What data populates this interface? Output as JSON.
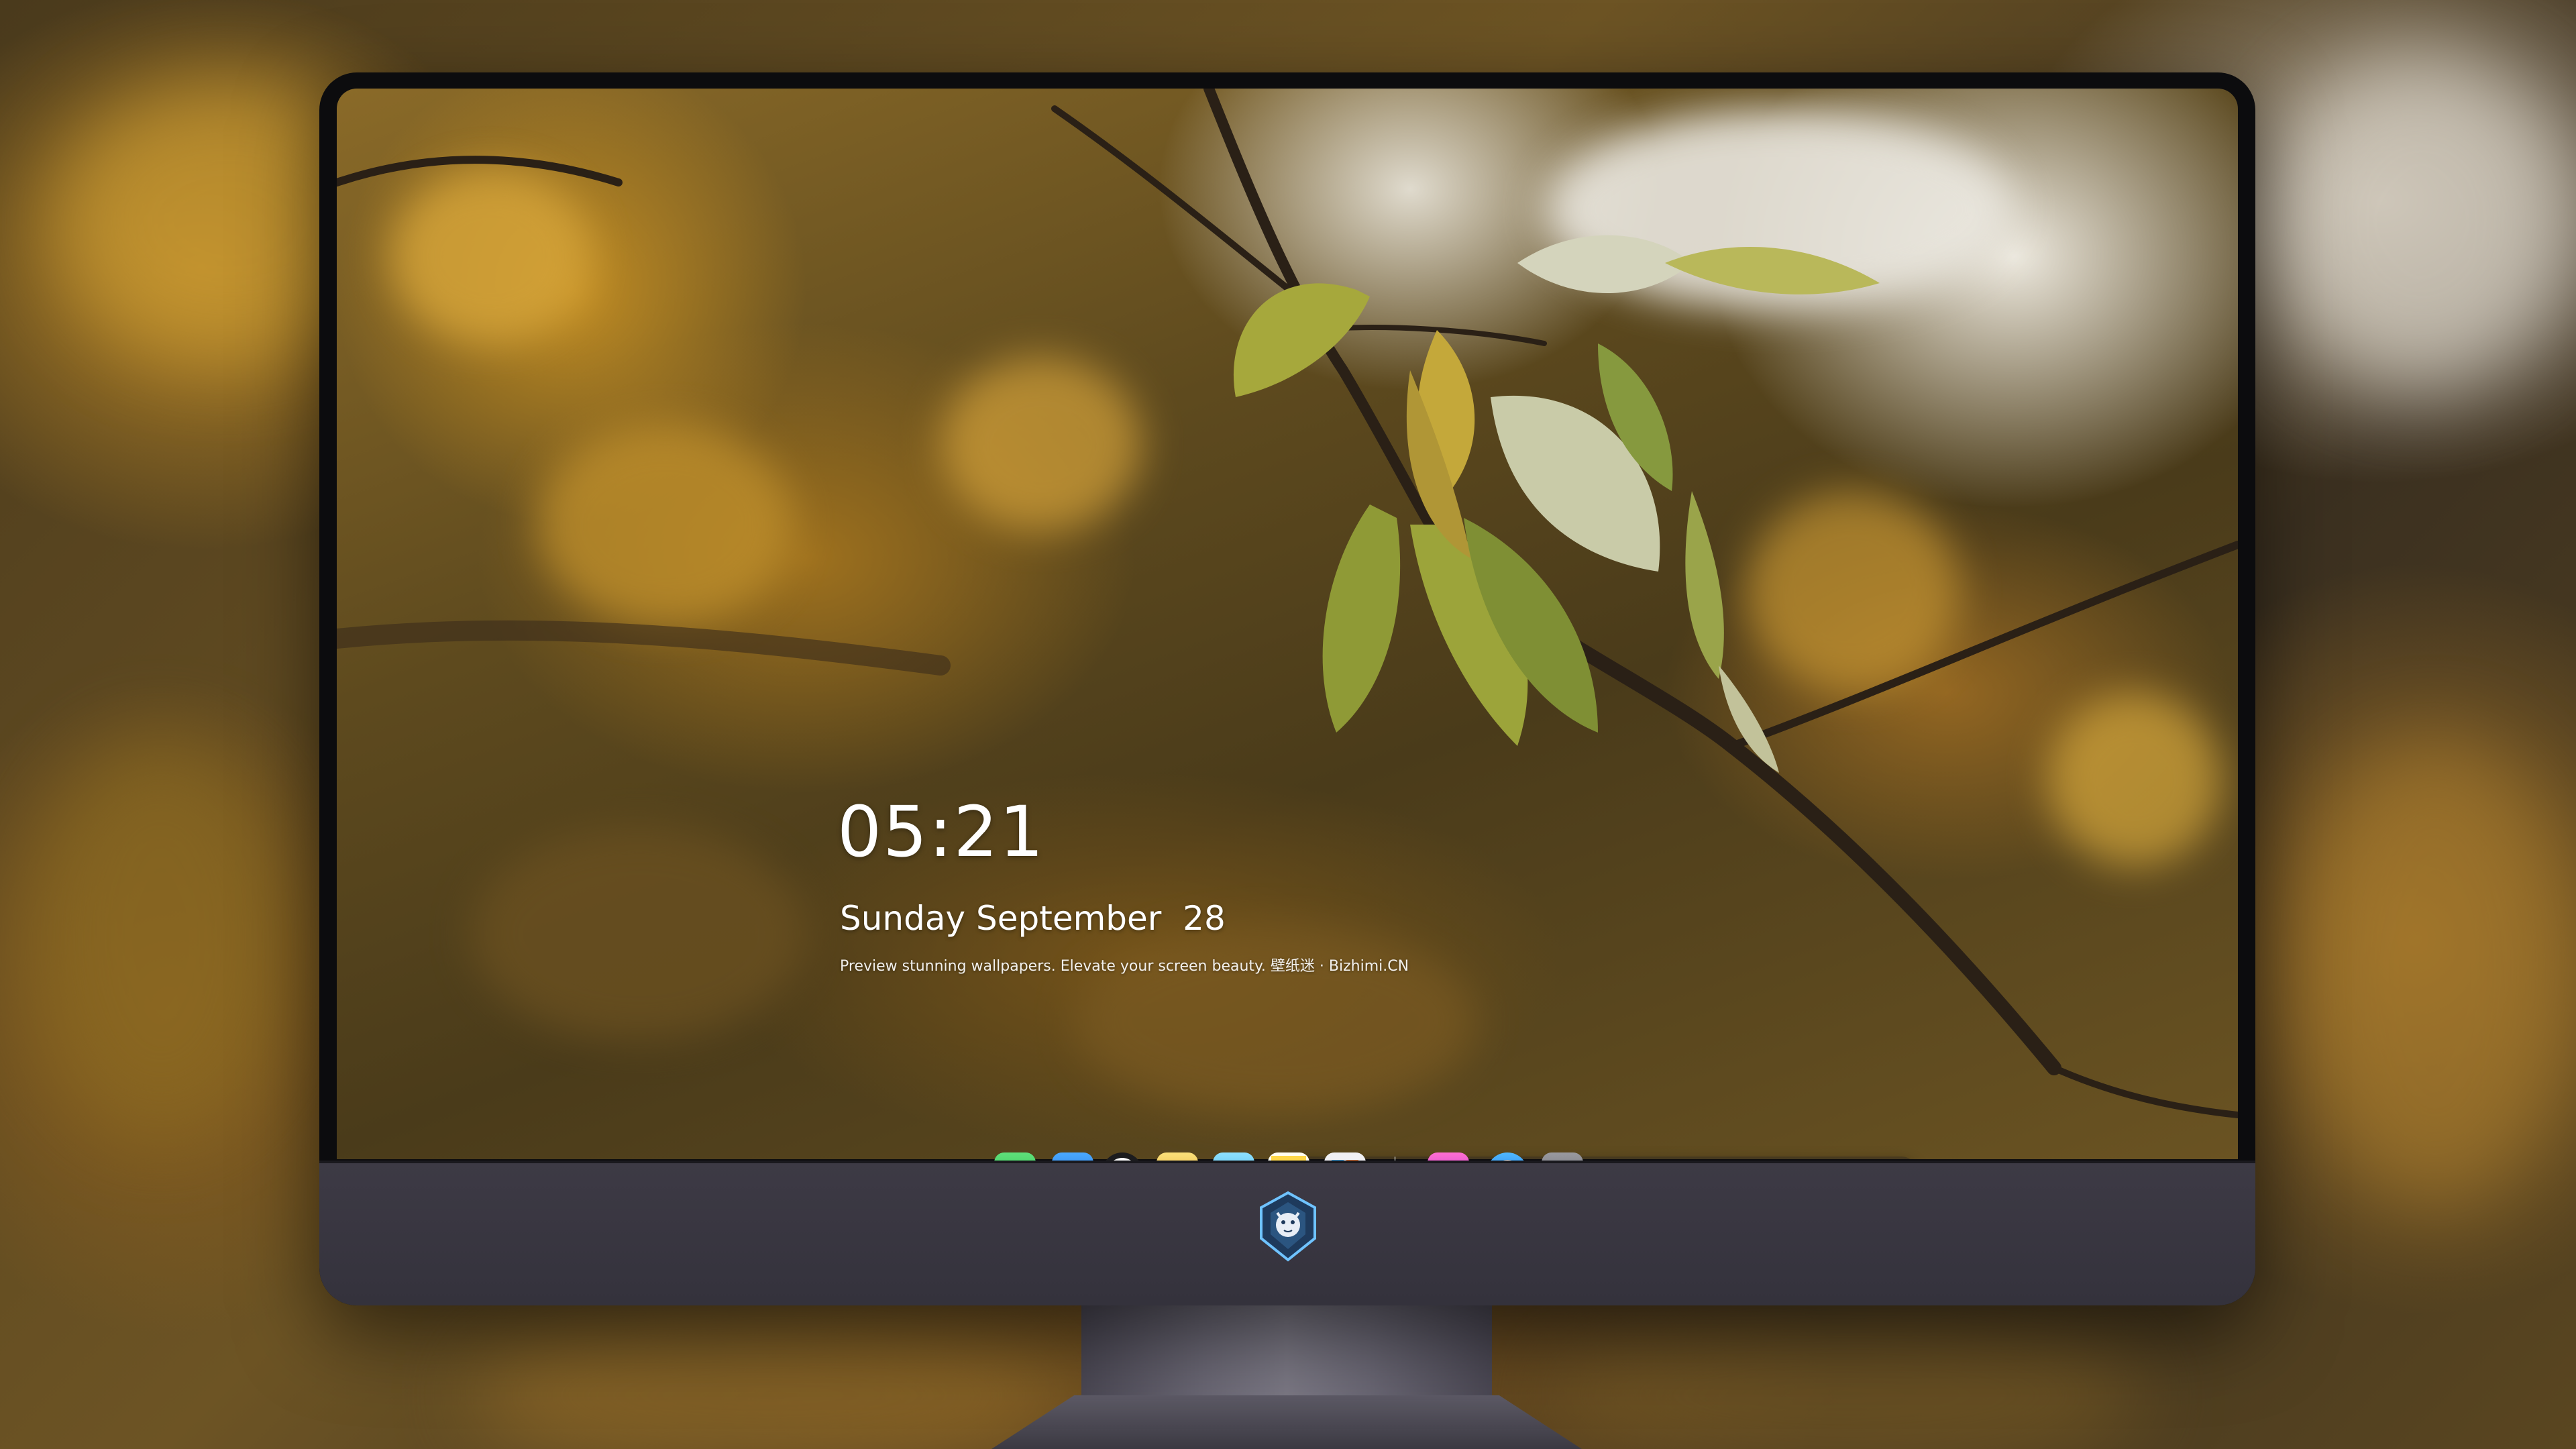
{
  "lock_screen": {
    "time": "05:21",
    "date": "Sunday September  28",
    "tagline": "Preview stunning wallpapers. Elevate your screen beauty. 壁纸迷 · Bizhimi.CN"
  },
  "dock": {
    "apps": [
      {
        "name": "messages-icon",
        "color": "#34c759"
      },
      {
        "name": "weather-icon",
        "color": "#2f8cf0"
      },
      {
        "name": "clock-icon",
        "color": "#1c1c1e"
      },
      {
        "name": "preview-icon",
        "color": "#f5c542"
      },
      {
        "name": "clapperboard-icon",
        "color": "#4fc3e8"
      },
      {
        "name": "notes-icon",
        "color": "#ffd84a"
      },
      {
        "name": "photo-booth-icon",
        "color": "#e9e9ee"
      },
      {
        "name": "music-icon",
        "color": "#e64cc8"
      },
      {
        "name": "app-store-icon",
        "color": "#1e8cf5"
      },
      {
        "name": "camera-icon",
        "color": "#8e8e93"
      }
    ]
  },
  "chin": {
    "logo_icon": "dragon-badge-icon"
  }
}
